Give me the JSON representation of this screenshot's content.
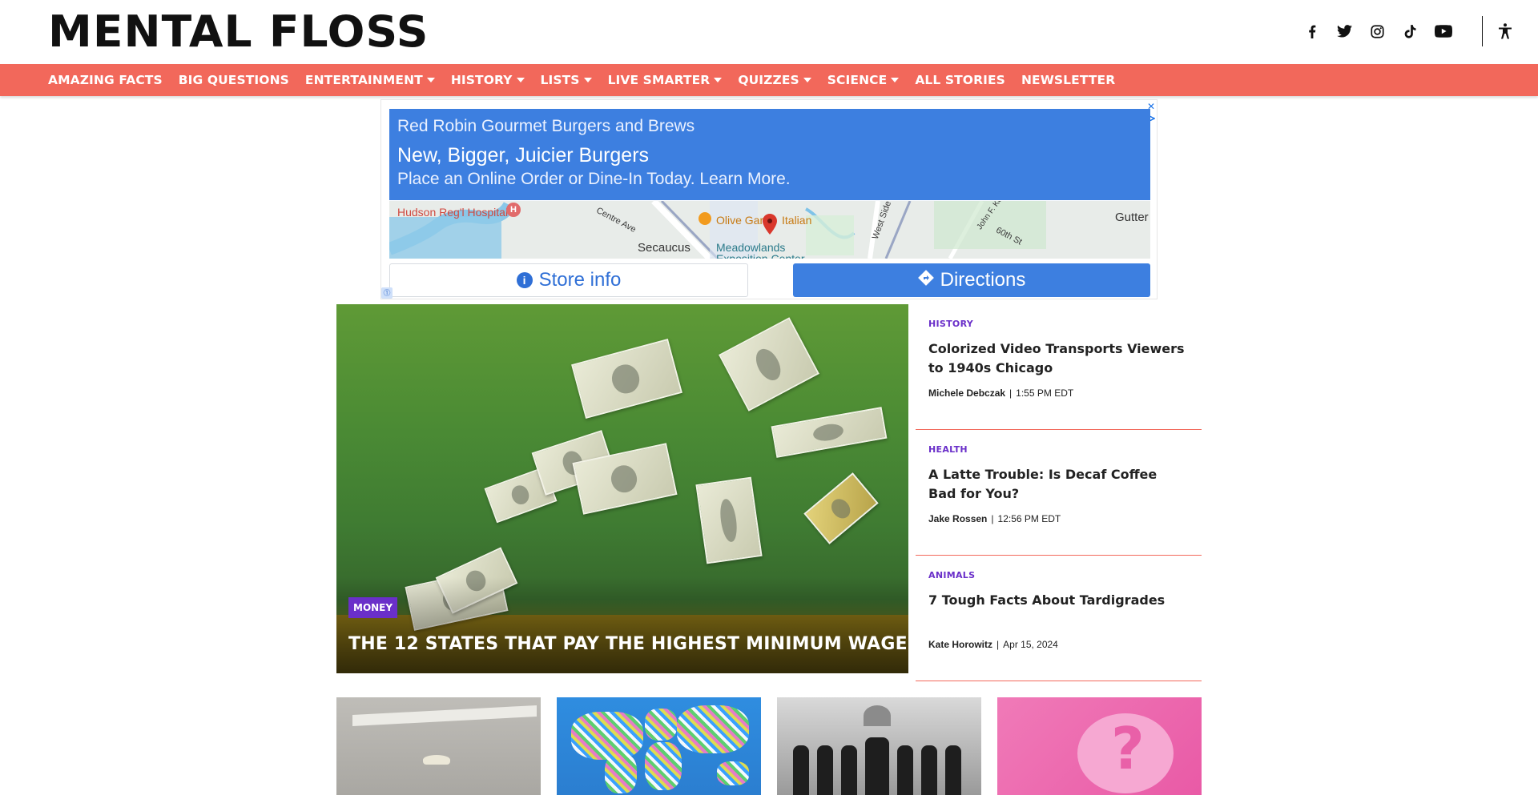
{
  "header": {
    "logo": "MENTAL FLOSS",
    "social": [
      "facebook-icon",
      "twitter-icon",
      "instagram-icon",
      "tiktok-icon",
      "youtube-icon"
    ],
    "accessibility_icon": "accessibility-icon"
  },
  "nav": {
    "items": [
      {
        "label": "AMAZING FACTS",
        "dropdown": false
      },
      {
        "label": "BIG QUESTIONS",
        "dropdown": false
      },
      {
        "label": "ENTERTAINMENT",
        "dropdown": true
      },
      {
        "label": "HISTORY",
        "dropdown": true
      },
      {
        "label": "LISTS",
        "dropdown": true
      },
      {
        "label": "LIVE SMARTER",
        "dropdown": true
      },
      {
        "label": "QUIZZES",
        "dropdown": true
      },
      {
        "label": "SCIENCE",
        "dropdown": true
      },
      {
        "label": "ALL STORIES",
        "dropdown": false
      },
      {
        "label": "NEWSLETTER",
        "dropdown": false
      }
    ],
    "bar_color": "#f2685b"
  },
  "ad": {
    "advertiser": "Red Robin Gourmet Burgers and Brews",
    "headline": "New, Bigger, Juicier Burgers",
    "description": "Place an Online Order or Dine-In Today. Learn More.",
    "map_labels": {
      "hospital": "Hudson Reg'l Hospital",
      "centre": "Centre Ave",
      "secaucus": "Secaucus",
      "olive": "Olive Gar",
      "italian": "Italian",
      "meadowlands": "Meadowlands",
      "expo": "Exposition Center",
      "westside": "West Side",
      "johnf": "John F. Ke",
      "sixtieth": "60th St",
      "gutter": "Gutter"
    },
    "store_info_label": "Store info",
    "directions_label": "Directions",
    "accent": "#3d7fe0"
  },
  "hero": {
    "category": "MONEY",
    "title": "THE 12 STATES THAT PAY THE HIGHEST MINIMUM WAGE",
    "badge_color": "#6a2fc9"
  },
  "stories": [
    {
      "category": "HISTORY",
      "title": "Colorized Video Transports Viewers to 1940s Chicago",
      "author": "Michele Debczak",
      "time": "1:55 PM EDT"
    },
    {
      "category": "HEALTH",
      "title": "A Latte Trouble: Is Decaf Coffee Bad for You?",
      "author": "Jake Rossen",
      "time": "12:56 PM EDT"
    },
    {
      "category": "ANIMALS",
      "title": "7 Tough Facts About Tardigrades",
      "author": "Kate Horowitz",
      "time": "Apr 15, 2024"
    }
  ],
  "thumbnails": [
    "shoe-on-road-image",
    "world-map-collage-image",
    "marching-group-photo-image",
    "pink-question-bubble-image"
  ]
}
